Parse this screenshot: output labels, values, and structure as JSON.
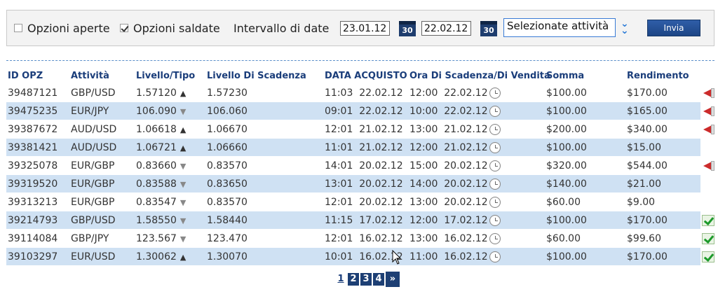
{
  "filters": {
    "open_options_label": "Opzioni aperte",
    "open_options_checked": false,
    "settled_options_label": "Opzioni saldate",
    "settled_options_checked": true,
    "date_range_label": "Intervallo di date",
    "date_from": "23.01.12",
    "date_to": "22.02.12",
    "calendar_icon_text": "30",
    "asset_select_value": "Selezionate attività",
    "submit_label": "Invia"
  },
  "table": {
    "headers": [
      "ID OPZ",
      "Attività",
      "Livello/Tipo",
      "Livello Di Scadenza",
      "DATA ACQUISTO",
      "Ora Di Scadenza/Di Vendita",
      "Somma",
      "Rendimento"
    ],
    "rows": [
      {
        "id": "39487121",
        "asset": "GBP/USD",
        "level": "1.57120",
        "dir": "up",
        "expiry_level": "1.57230",
        "buy_time": "11:03",
        "buy_date": "22.02.12",
        "exp_time": "12:00",
        "exp_date": "22.02.12",
        "amount": "$100.00",
        "return": "$170.00",
        "status_icon": "megaphone-icon"
      },
      {
        "id": "39475235",
        "asset": "EUR/JPY",
        "level": "106.090",
        "dir": "down",
        "expiry_level": "106.060",
        "buy_time": "09:01",
        "buy_date": "22.02.12",
        "exp_time": "10:00",
        "exp_date": "22.02.12",
        "amount": "$100.00",
        "return": "$165.00",
        "status_icon": "megaphone-icon"
      },
      {
        "id": "39387672",
        "asset": "AUD/USD",
        "level": "1.06618",
        "dir": "up",
        "expiry_level": "1.06670",
        "buy_time": "12:01",
        "buy_date": "21.02.12",
        "exp_time": "13:00",
        "exp_date": "21.02.12",
        "amount": "$200.00",
        "return": "$340.00",
        "status_icon": "megaphone-icon"
      },
      {
        "id": "39381421",
        "asset": "AUD/USD",
        "level": "1.06721",
        "dir": "up",
        "expiry_level": "1.06660",
        "buy_time": "11:01",
        "buy_date": "21.02.12",
        "exp_time": "12:00",
        "exp_date": "21.02.12",
        "amount": "$100.00",
        "return": "$15.00",
        "status_icon": ""
      },
      {
        "id": "39325078",
        "asset": "EUR/GBP",
        "level": "0.83660",
        "dir": "down",
        "expiry_level": "0.83570",
        "buy_time": "14:01",
        "buy_date": "20.02.12",
        "exp_time": "15:00",
        "exp_date": "20.02.12",
        "amount": "$320.00",
        "return": "$544.00",
        "status_icon": "megaphone-icon"
      },
      {
        "id": "39319520",
        "asset": "EUR/GBP",
        "level": "0.83588",
        "dir": "down",
        "expiry_level": "0.83650",
        "buy_time": "13:01",
        "buy_date": "20.02.12",
        "exp_time": "14:00",
        "exp_date": "20.02.12",
        "amount": "$140.00",
        "return": "$21.00",
        "status_icon": ""
      },
      {
        "id": "39313213",
        "asset": "EUR/GBP",
        "level": "0.83547",
        "dir": "down",
        "expiry_level": "0.83570",
        "buy_time": "12:01",
        "buy_date": "20.02.12",
        "exp_time": "13:00",
        "exp_date": "20.02.12",
        "amount": "$60.00",
        "return": "$9.00",
        "status_icon": ""
      },
      {
        "id": "39214793",
        "asset": "GBP/USD",
        "level": "1.58550",
        "dir": "down",
        "expiry_level": "1.58440",
        "buy_time": "11:15",
        "buy_date": "17.02.12",
        "exp_time": "12:00",
        "exp_date": "17.02.12",
        "amount": "$100.00",
        "return": "$170.00",
        "status_icon": "check-icon"
      },
      {
        "id": "39114084",
        "asset": "GBP/JPY",
        "level": "123.567",
        "dir": "down",
        "expiry_level": "123.470",
        "buy_time": "12:01",
        "buy_date": "16.02.12",
        "exp_time": "13:00",
        "exp_date": "16.02.12",
        "amount": "$60.00",
        "return": "$99.60",
        "status_icon": "check-icon"
      },
      {
        "id": "39103297",
        "asset": "EUR/USD",
        "level": "1.30062",
        "dir": "up",
        "expiry_level": "1.30070",
        "buy_time": "10:01",
        "buy_date": "16.02.12",
        "exp_time": "11:00",
        "exp_date": "16.02.12",
        "amount": "$100.00",
        "return": "$170.00",
        "status_icon": "check-icon"
      }
    ]
  },
  "pagination": {
    "pages": [
      "1",
      "2",
      "3",
      "4"
    ],
    "current": "1",
    "next_label": "»"
  },
  "colors": {
    "header_text": "#1a3d7a",
    "row_stripe": "#cfe1f3",
    "button_bg": "#1d4585"
  }
}
